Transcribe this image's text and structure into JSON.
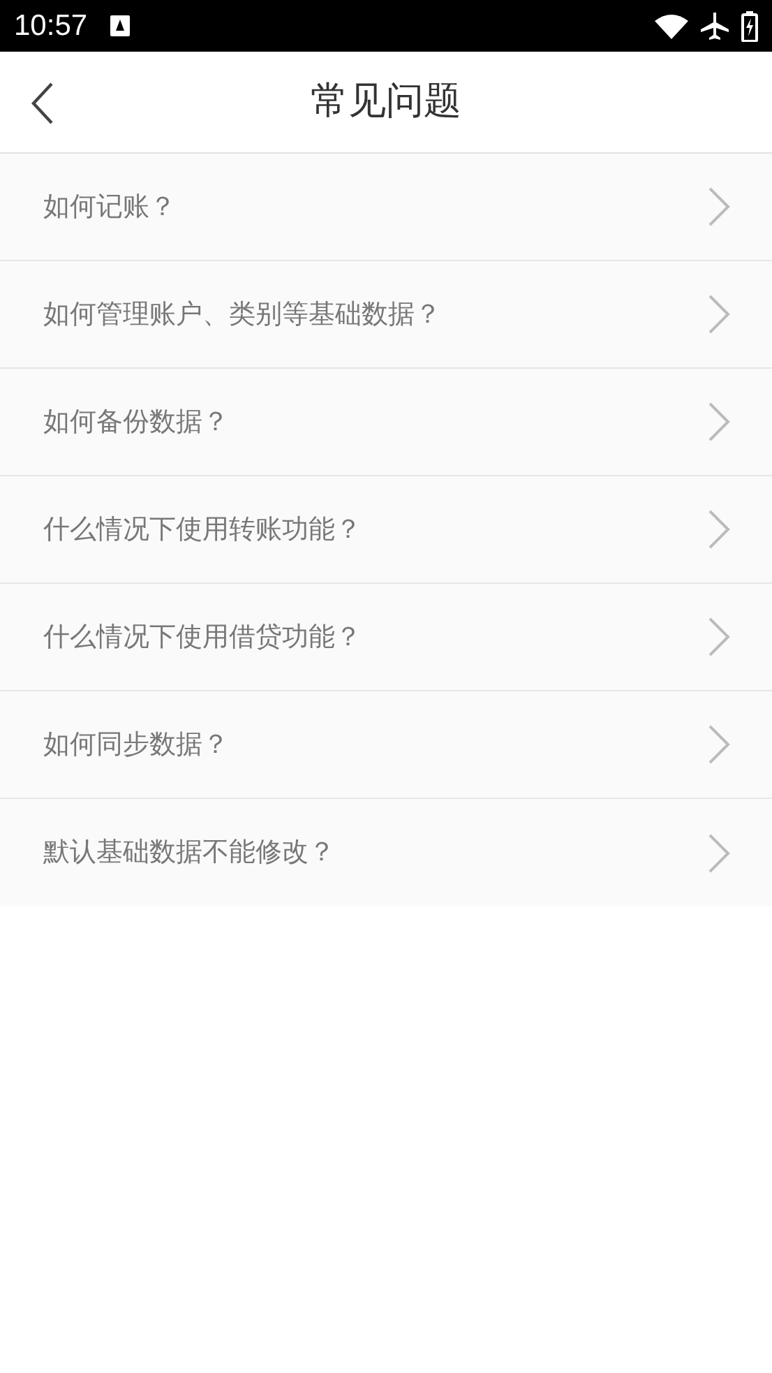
{
  "status_bar": {
    "time": "10:57"
  },
  "header": {
    "title": "常见问题"
  },
  "faq_items": [
    {
      "question": "如何记账？"
    },
    {
      "question": "如何管理账户、类别等基础数据？"
    },
    {
      "question": "如何备份数据？"
    },
    {
      "question": "什么情况下使用转账功能？"
    },
    {
      "question": "什么情况下使用借贷功能？"
    },
    {
      "question": "如何同步数据？"
    },
    {
      "question": "默认基础数据不能修改？"
    }
  ]
}
